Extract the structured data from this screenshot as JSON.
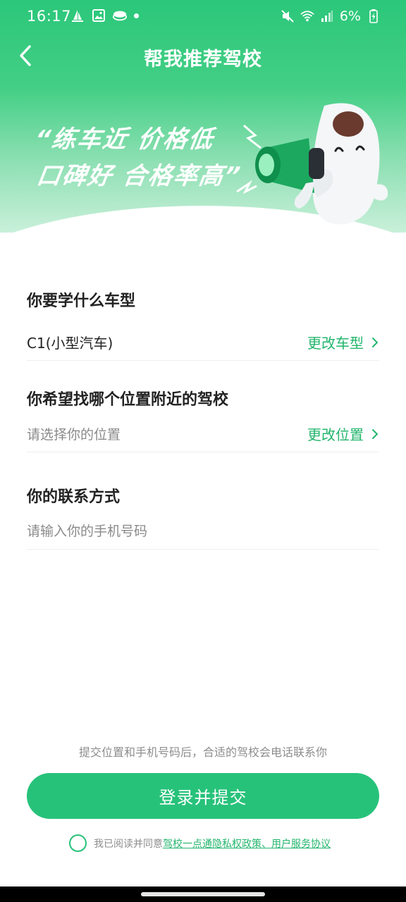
{
  "status_bar": {
    "time": "16:17",
    "battery": "6%",
    "left_icons": [
      "sailboat-icon",
      "image-icon",
      "stack-icon",
      "dot-icon"
    ],
    "right_icons": [
      "mute-icon",
      "wifi-icon",
      "signal-icon",
      "battery-icon"
    ]
  },
  "nav": {
    "title": "帮我推荐驾校"
  },
  "banner": {
    "slogan_line1": "“练车近 价格低",
    "slogan_line2": "口碑好 合格率高”"
  },
  "form": {
    "car_type": {
      "label": "你要学什么车型",
      "value": "C1(小型汽车)",
      "action": "更改车型"
    },
    "location": {
      "label": "你希望找哪个位置附近的驾校",
      "placeholder": "请选择你的位置",
      "action": "更改位置"
    },
    "contact": {
      "label": "你的联系方式",
      "placeholder": "请输入你的手机号码"
    }
  },
  "footer": {
    "tip": "提交位置和手机号码后，合适的驾校会电话联系你",
    "submit_label": "登录并提交",
    "agree_prefix": "我已阅读并同意",
    "agree_link": "驾校一点通隐私权政策、用户服务协议"
  },
  "colors": {
    "brand_green": "#27c27a",
    "link_green": "#23b56c",
    "hint_gray": "#8d8d8d"
  }
}
